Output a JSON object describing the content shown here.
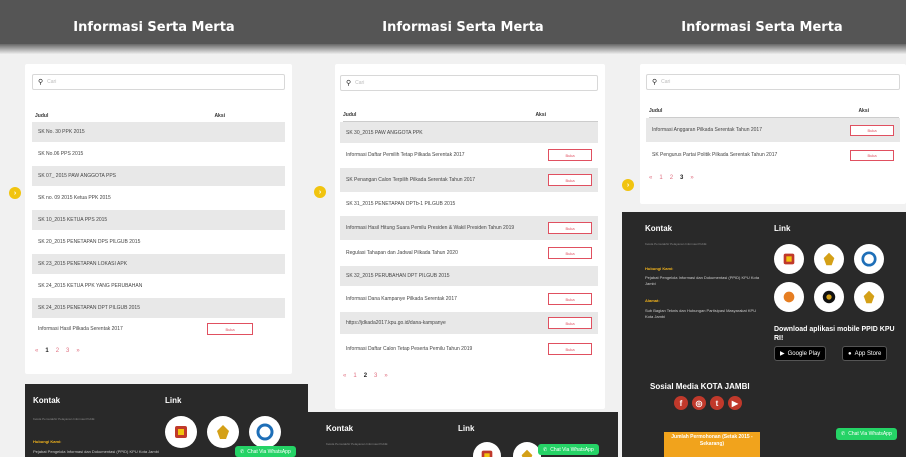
{
  "page_title": "Informasi Serta Merta",
  "search_placeholder": "Cari",
  "columns": {
    "judul": "Judul",
    "aksi": "Aksi"
  },
  "buka": "Buka",
  "panel1": {
    "rows": [
      "SK No. 30 PPK 2015",
      "SK No.06 PPS 2015",
      "SK 07_ 2015 PAW ANGGOTA PPS",
      "SK no. 09 2015 Ketua PPK 2015",
      "SK 10_2015 KETUA PPS 2015",
      "SK 20_2015 PENETAPAN DPS PILGUB 2015",
      "SK 23_2015 PENETAPAN LOKASI APK",
      "SK 24_2015 KETUA PPK YANG PERUBAHAN",
      "SK 24_2015 PENETAPAN DPT PILGUB 2015",
      "Informasi Hasil Pilkada Serentak 2017"
    ],
    "pages": [
      "«",
      "1",
      "2",
      "3",
      "»"
    ]
  },
  "panel2": {
    "rows": [
      "SK 30_2015 PAW ANGGOTA PPK",
      "Informasi Daftar Pemilih Tetap Pilkada Serentak 2017",
      "SK Penangan Calon Terpilih Pilkada Serentak Tahun 2017",
      "SK 31_2015 PENETAPAN DPTb-1 PILGUB 2015",
      "Informasi Hasil Hitung Suara Pemilu Presiden & Wakil Presiden Tahun 2019",
      "Regulasi Tahapan dan Jadwal Pilkada Tahun 2020",
      "SK 32_2015 PERUBAHAN DPT PILGUB 2015",
      "Informasi Dana Kampanye Pilkada Serentak 2017",
      "https://jdkada2017.kpu.go.id/dana-kampanye",
      "Informasi Daftar Calon Tetap Peserta Pemilu Tahun 2019"
    ],
    "pages": [
      "«",
      "1",
      "2",
      "3",
      "»"
    ]
  },
  "panel3": {
    "rows": [
      "Informasi Anggaran Pilkada Serentak Tahun 2017",
      "SK Pengurus Partai Politik Pilkada Serentak Tahun 2017"
    ],
    "pages": [
      "«",
      "1",
      "2",
      "3",
      "»"
    ]
  },
  "side_button_icon": "chevron-right-icon",
  "side_button_glyph": "›",
  "footer": {
    "kontak": "Kontak",
    "link": "Link",
    "sub": "Kelola Pemutakhir Pelayanan Informasi Publik",
    "hubungi_label": "Hubungi Kami:",
    "hubungi_text": "Pejabat Pengelola Informasi dan Dokumentasi (PPID) KPU Kota Jambi",
    "alamat_label": "Alamat:",
    "alamat_text": "Sub Bagian Teknis dan Hubungan Partisipasi Masyarakat KPU Kota Jambi",
    "download": "Download aplikasi mobile PPID KPU RI!",
    "google_play": "Google Play",
    "app_store": "App Store",
    "sosial": "Sosial Media KOTA JAMBI",
    "jumlah": "Jumlah Permohonan (Setak 2015 - Sekarang)",
    "chat": "Chat Via WhatsApp"
  },
  "colors": {
    "accent_red": "#e05060",
    "gold": "#f1c40f",
    "whatsapp": "#25d366",
    "footer_bg": "#292929"
  }
}
